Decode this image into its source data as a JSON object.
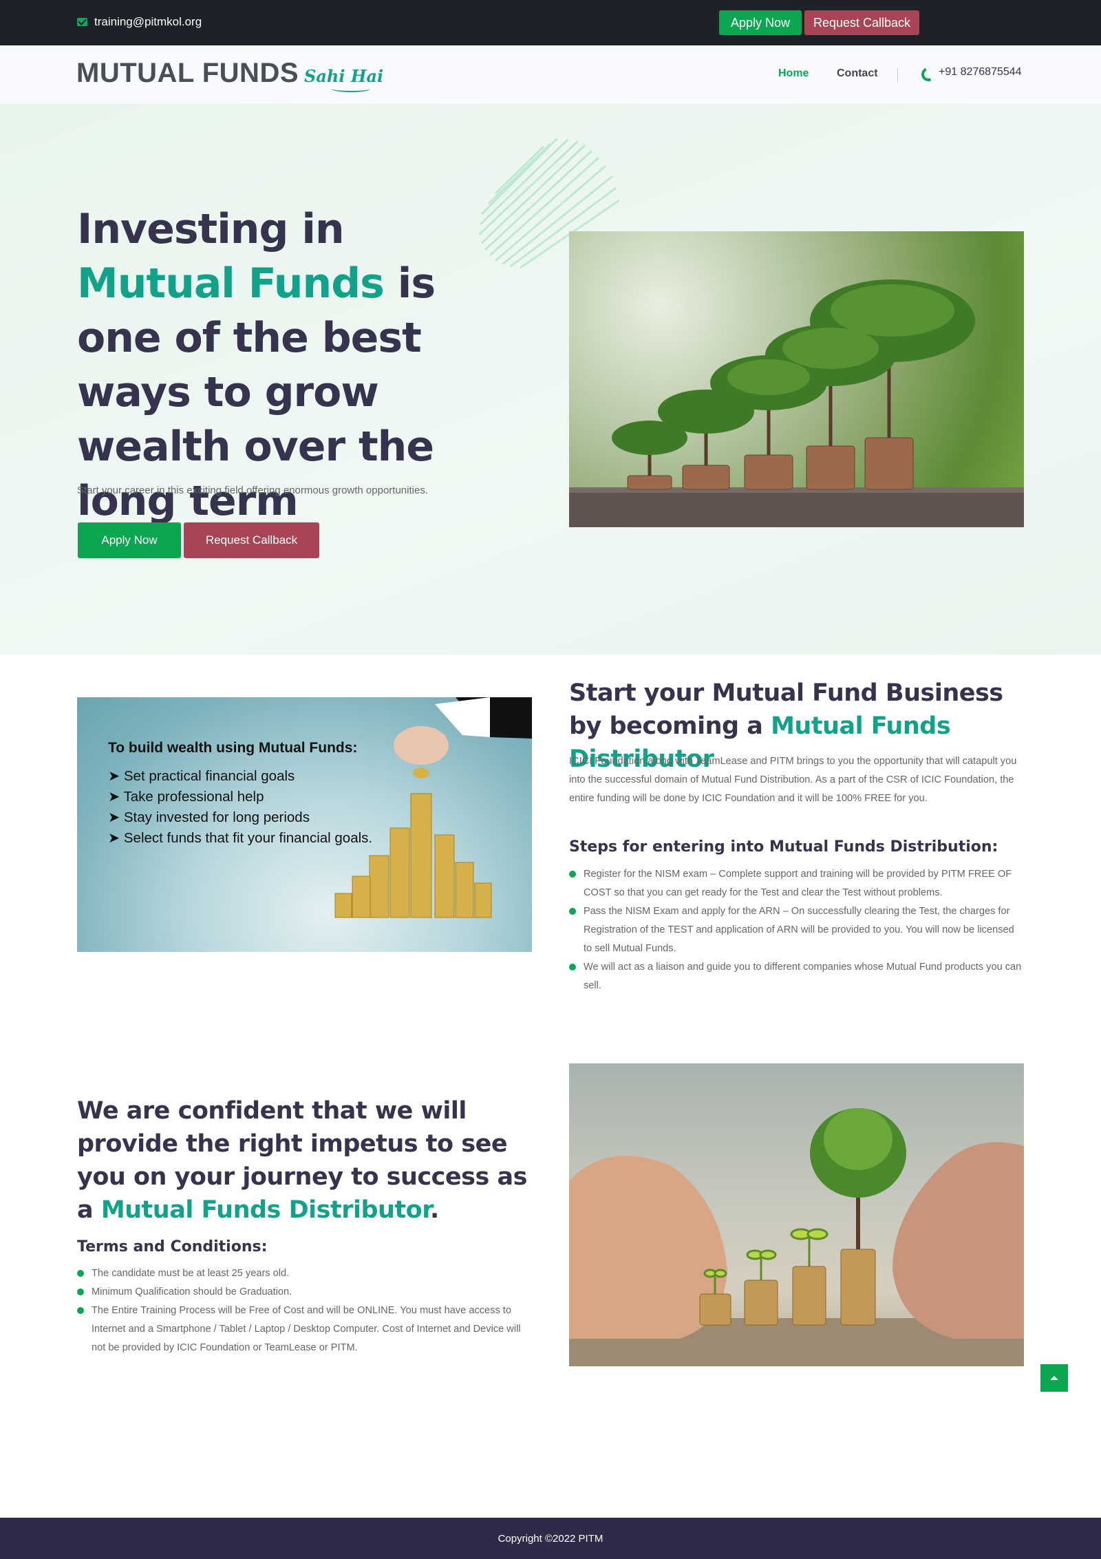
{
  "topbar": {
    "email": "training@pitmkol.org",
    "apply_label": "Apply Now",
    "callback_label": "Request Callback"
  },
  "nav": {
    "logo_main": "MUTUAL FUNDS",
    "logo_script": "Sahi Hai",
    "links": [
      {
        "label": "Home",
        "active": true
      },
      {
        "label": "Contact",
        "active": false
      }
    ],
    "phone": "+91 8276875544"
  },
  "hero": {
    "heading_part1": "Investing in ",
    "heading_highlight": "Mutual Funds",
    "heading_part2": " is one of the best ways to grow wealth over the long term",
    "subtitle": "Start your career in this exciting field offering enormous growth opportunities.",
    "apply_label": "Apply Now",
    "callback_label": "Request Callback"
  },
  "section2": {
    "image_title": "To build wealth using Mutual Funds:",
    "image_items": [
      "Set practical financial goals",
      "Take professional help",
      "Stay invested for long periods",
      "Select funds that fit your financial goals."
    ],
    "title_part1": "Start your Mutual Fund Business by becoming a ",
    "title_highlight": "Mutual Funds Distributor",
    "paragraph": "ICICI Foundation along with TeamLease and PITM brings to you the opportunity that will catapult you into the successful domain of Mutual Fund Distribution. As a part of the CSR of ICIC Foundation, the entire funding will be done by ICIC Foundation and it will be 100% FREE for you.",
    "steps_title": "Steps for entering into Mutual Funds Distribution:",
    "steps": [
      "Register for the NISM exam – Complete support and training will be provided by PITM FREE OF COST so that you can get ready for the Test and clear the Test without problems.",
      "Pass the NISM Exam and apply for the ARN – On successfully clearing the Test, the charges for Registration of the TEST and application of ARN will be provided to you. You will now be licensed to sell Mutual Funds.",
      "We will act as a liaison and guide you to different companies whose Mutual Fund products you can sell."
    ]
  },
  "section3": {
    "title_part1": "We are confident that we will provide the right impetus to see you on your journey to success as a ",
    "title_highlight": "Mutual Funds Distributor",
    "title_end": ".",
    "terms_title": "Terms and Conditions:",
    "terms": [
      "The candidate must be at least 25 years old.",
      "Minimum Qualification should be Graduation.",
      "The Entire Training Process will be Free of Cost and will be ONLINE. You must have access to Internet and a Smartphone / Tablet / Laptop / Desktop Computer. Cost of Internet and Device will not be provided by ICIC Foundation or TeamLease or PITM."
    ]
  },
  "footer": {
    "copyright": "Copyright ©2022 PITM"
  },
  "colors": {
    "accent_green": "#0aa652",
    "highlight_teal": "#12a28a",
    "callback_red": "#a84554",
    "dark_navy": "#35334d"
  },
  "icons": [
    "mail-icon",
    "phone-icon",
    "arrow-up-icon"
  ]
}
